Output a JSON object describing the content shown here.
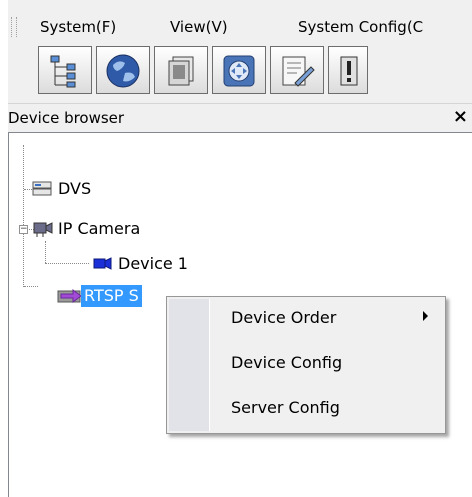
{
  "menubar": {
    "items": [
      {
        "label": "System(F)",
        "name": "menu-system"
      },
      {
        "label": "View(V)",
        "name": "menu-view"
      },
      {
        "label": "System Config(C",
        "name": "menu-system-config"
      }
    ]
  },
  "toolbar": {
    "buttons": [
      {
        "icon": "device-tree-icon"
      },
      {
        "icon": "globe-icon"
      },
      {
        "icon": "document-layers-icon"
      },
      {
        "icon": "ptz-control-icon"
      },
      {
        "icon": "notepad-edit-icon"
      },
      {
        "icon": "alert-icon"
      }
    ]
  },
  "panel": {
    "title": "Device browser",
    "close_label": "×"
  },
  "tree": {
    "nodes": [
      {
        "label": "DVS",
        "icon": "dvs-icon"
      },
      {
        "label": "IP Camera",
        "icon": "ip-camera-icon"
      },
      {
        "label": "Device 1",
        "icon": "camera-device-icon"
      },
      {
        "label": "RTSP S",
        "icon": "rtsp-server-icon"
      }
    ]
  },
  "context_menu": {
    "items": [
      {
        "label": "Device Order"
      },
      {
        "label": "Device Config"
      },
      {
        "label": "Server Config"
      }
    ]
  },
  "colors": {
    "selection": "#3399ff",
    "window_bg": "#f0f0f0",
    "menu_gutter": "#e2e3e8"
  }
}
